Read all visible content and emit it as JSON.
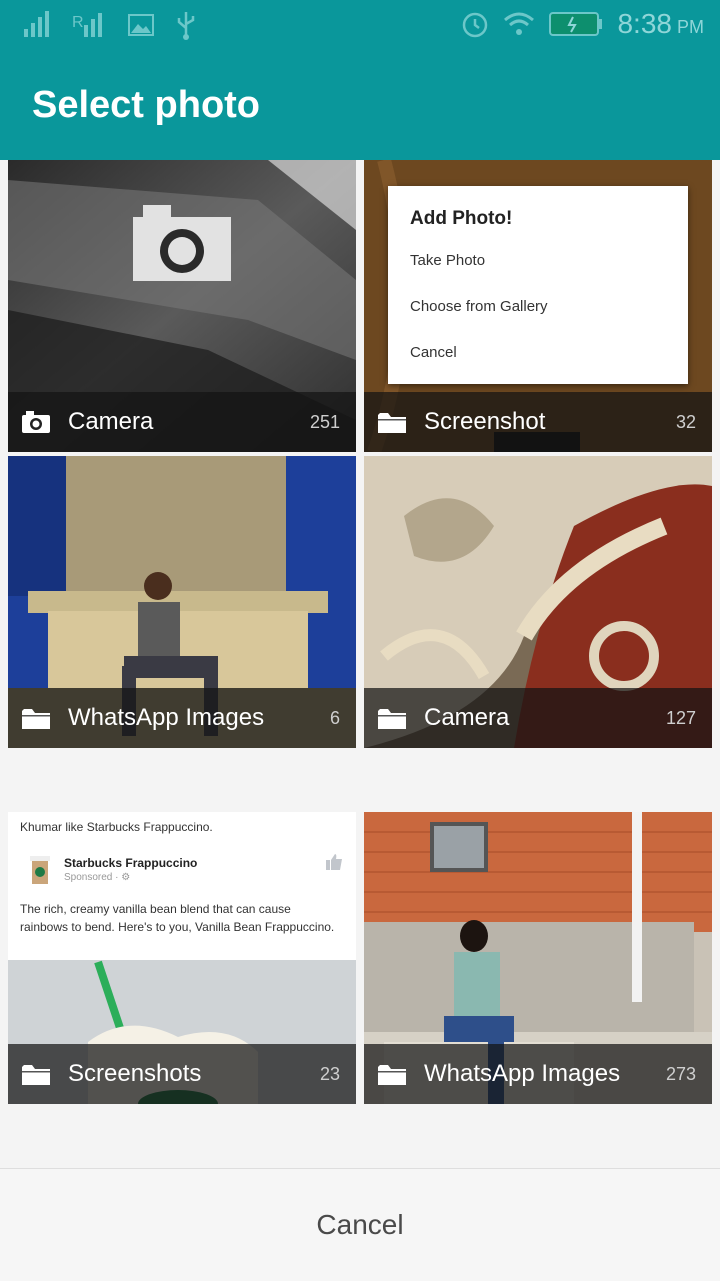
{
  "status_bar": {
    "time": "8:38",
    "ampm": "PM"
  },
  "header": {
    "title": "Select photo",
    "bg_color": "#0a979b"
  },
  "albums": [
    {
      "name": "Camera",
      "count": "251",
      "icon": "camera-icon"
    },
    {
      "name": "Screenshot",
      "count": "32",
      "icon": "folder-icon"
    },
    {
      "name": "WhatsApp Images",
      "count": "6",
      "icon": "folder-icon"
    },
    {
      "name": "Camera",
      "count": "127",
      "icon": "folder-icon"
    },
    {
      "name": "Screenshots",
      "count": "23",
      "icon": "folder-icon"
    },
    {
      "name": "WhatsApp Images",
      "count": "273",
      "icon": "folder-icon"
    }
  ],
  "screenshot_thumb": {
    "dialog_title": "Add Photo!",
    "take_photo": "Take Photo",
    "choose_gallery": "Choose from Gallery",
    "cancel": "Cancel"
  },
  "screenshots_thumb": {
    "post_header": "Khumar like Starbucks Frappuccino.",
    "page_name": "Starbucks Frappuccino",
    "sponsored": "Sponsored · ⚙",
    "body": "The rich, creamy vanilla bean blend that can cause rainbows to bend. Here's to you, Vanilla Bean Frappuccino."
  },
  "footer": {
    "cancel_label": "Cancel"
  }
}
